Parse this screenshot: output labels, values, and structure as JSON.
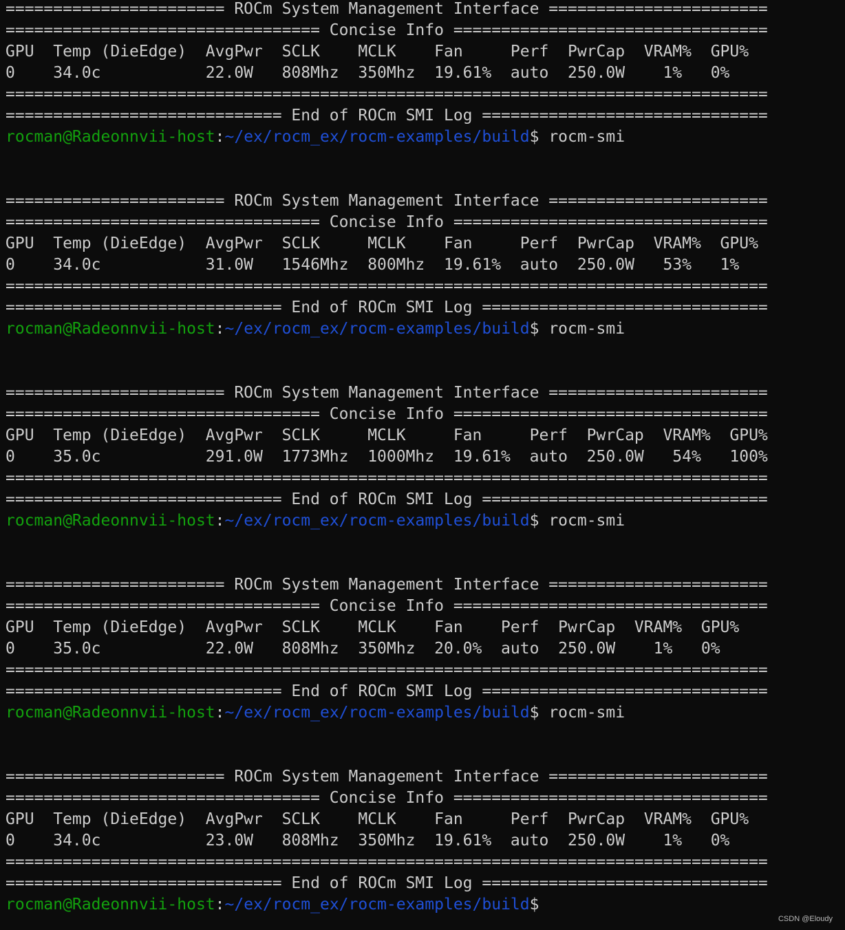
{
  "prompt": {
    "user_host": "rocman@Radeonnvii-host",
    "colon": ":",
    "path": "~/ex/rocm_ex/rocm-examples/build",
    "dollar": "$"
  },
  "watermark": "CSDN @Eloudy",
  "colors": {
    "background": "#0c0c0c",
    "text": "#cccccc",
    "prompt_user": "#13a10e",
    "prompt_path": "#1f4fd6"
  },
  "lines": [
    {
      "type": "text",
      "text": "======================= ROCm System Management Interface ======================="
    },
    {
      "type": "text",
      "text": "================================= Concise Info ================================="
    },
    {
      "type": "text",
      "text": "GPU  Temp (DieEdge)  AvgPwr  SCLK    MCLK    Fan     Perf  PwrCap  VRAM%  GPU%"
    },
    {
      "type": "text",
      "text": "0    34.0c           22.0W   808Mhz  350Mhz  19.61%  auto  250.0W    1%   0%"
    },
    {
      "type": "text",
      "text": "================================================================================"
    },
    {
      "type": "text",
      "text": "============================= End of ROCm SMI Log =============================="
    },
    {
      "type": "prompt",
      "command": " rocm-smi"
    },
    {
      "type": "text",
      "text": ""
    },
    {
      "type": "text",
      "text": ""
    },
    {
      "type": "text",
      "text": "======================= ROCm System Management Interface ======================="
    },
    {
      "type": "text",
      "text": "================================= Concise Info ================================="
    },
    {
      "type": "text",
      "text": "GPU  Temp (DieEdge)  AvgPwr  SCLK     MCLK    Fan     Perf  PwrCap  VRAM%  GPU%"
    },
    {
      "type": "text",
      "text": "0    34.0c           31.0W   1546Mhz  800Mhz  19.61%  auto  250.0W   53%   1%"
    },
    {
      "type": "text",
      "text": "================================================================================"
    },
    {
      "type": "text",
      "text": "============================= End of ROCm SMI Log =============================="
    },
    {
      "type": "prompt",
      "command": " rocm-smi"
    },
    {
      "type": "text",
      "text": ""
    },
    {
      "type": "text",
      "text": ""
    },
    {
      "type": "text",
      "text": "======================= ROCm System Management Interface ======================="
    },
    {
      "type": "text",
      "text": "================================= Concise Info ================================="
    },
    {
      "type": "text",
      "text": "GPU  Temp (DieEdge)  AvgPwr  SCLK     MCLK     Fan     Perf  PwrCap  VRAM%  GPU%"
    },
    {
      "type": "text",
      "text": "0    35.0c           291.0W  1773Mhz  1000Mhz  19.61%  auto  250.0W   54%   100%"
    },
    {
      "type": "text",
      "text": "================================================================================"
    },
    {
      "type": "text",
      "text": "============================= End of ROCm SMI Log =============================="
    },
    {
      "type": "prompt",
      "command": " rocm-smi"
    },
    {
      "type": "text",
      "text": ""
    },
    {
      "type": "text",
      "text": ""
    },
    {
      "type": "text",
      "text": "======================= ROCm System Management Interface ======================="
    },
    {
      "type": "text",
      "text": "================================= Concise Info ================================="
    },
    {
      "type": "text",
      "text": "GPU  Temp (DieEdge)  AvgPwr  SCLK    MCLK    Fan    Perf  PwrCap  VRAM%  GPU%"
    },
    {
      "type": "text",
      "text": "0    35.0c           22.0W   808Mhz  350Mhz  20.0%  auto  250.0W    1%   0%"
    },
    {
      "type": "text",
      "text": "================================================================================"
    },
    {
      "type": "text",
      "text": "============================= End of ROCm SMI Log =============================="
    },
    {
      "type": "prompt",
      "command": " rocm-smi"
    },
    {
      "type": "text",
      "text": ""
    },
    {
      "type": "text",
      "text": ""
    },
    {
      "type": "text",
      "text": "======================= ROCm System Management Interface ======================="
    },
    {
      "type": "text",
      "text": "================================= Concise Info ================================="
    },
    {
      "type": "text",
      "text": "GPU  Temp (DieEdge)  AvgPwr  SCLK    MCLK    Fan     Perf  PwrCap  VRAM%  GPU%"
    },
    {
      "type": "text",
      "text": "0    34.0c           23.0W   808Mhz  350Mhz  19.61%  auto  250.0W    1%   0%"
    },
    {
      "type": "text",
      "text": "================================================================================"
    },
    {
      "type": "text",
      "text": "============================= End of ROCm SMI Log =============================="
    },
    {
      "type": "prompt",
      "command": ""
    }
  ]
}
